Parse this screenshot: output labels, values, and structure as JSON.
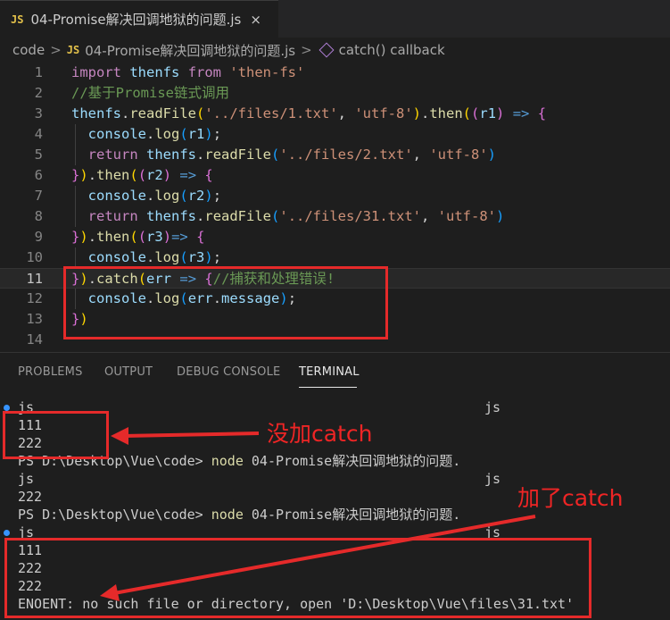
{
  "tab": {
    "badge": "JS",
    "title": "04-Promise解决回调地狱的问题.js",
    "close": "×"
  },
  "breadcrumb": {
    "root": "code",
    "sep": ">",
    "badge": "JS",
    "file": "04-Promise解决回调地狱的问题.js",
    "symbol": "catch() callback"
  },
  "editor": {
    "line_numbers": [
      "1",
      "2",
      "3",
      "4",
      "5",
      "6",
      "7",
      "8",
      "9",
      "10",
      "11",
      "12",
      "13",
      "14"
    ],
    "current_line": "11",
    "lines": [
      [
        {
          "c": "kw",
          "t": "import"
        },
        {
          "c": "op",
          "t": " "
        },
        {
          "c": "id",
          "t": "thenfs"
        },
        {
          "c": "op",
          "t": " "
        },
        {
          "c": "kw",
          "t": "from"
        },
        {
          "c": "op",
          "t": " "
        },
        {
          "c": "str",
          "t": "'then-fs'"
        }
      ],
      [
        {
          "c": "cm",
          "t": "//基于Promise链式调用"
        }
      ],
      [
        {
          "c": "id",
          "t": "thenfs"
        },
        {
          "c": "op",
          "t": "."
        },
        {
          "c": "fn",
          "t": "readFile"
        },
        {
          "c": "b1",
          "t": "("
        },
        {
          "c": "str",
          "t": "'../files/1.txt'"
        },
        {
          "c": "op",
          "t": ", "
        },
        {
          "c": "str",
          "t": "'utf-8'"
        },
        {
          "c": "b1",
          "t": ")"
        },
        {
          "c": "op",
          "t": "."
        },
        {
          "c": "fn",
          "t": "then"
        },
        {
          "c": "b1",
          "t": "("
        },
        {
          "c": "b2",
          "t": "("
        },
        {
          "c": "id",
          "t": "r1"
        },
        {
          "c": "b2",
          "t": ")"
        },
        {
          "c": "op",
          "t": " "
        },
        {
          "c": "kw2",
          "t": "=>"
        },
        {
          "c": "op",
          "t": " "
        },
        {
          "c": "b2",
          "t": "{"
        }
      ],
      [
        {
          "c": "op",
          "t": "  "
        },
        {
          "c": "id",
          "t": "console"
        },
        {
          "c": "op",
          "t": "."
        },
        {
          "c": "fn",
          "t": "log"
        },
        {
          "c": "b3",
          "t": "("
        },
        {
          "c": "id",
          "t": "r1"
        },
        {
          "c": "b3",
          "t": ")"
        },
        {
          "c": "op",
          "t": ";"
        }
      ],
      [
        {
          "c": "op",
          "t": "  "
        },
        {
          "c": "kw",
          "t": "return"
        },
        {
          "c": "op",
          "t": " "
        },
        {
          "c": "id",
          "t": "thenfs"
        },
        {
          "c": "op",
          "t": "."
        },
        {
          "c": "fn",
          "t": "readFile"
        },
        {
          "c": "b3",
          "t": "("
        },
        {
          "c": "str",
          "t": "'../files/2.txt'"
        },
        {
          "c": "op",
          "t": ", "
        },
        {
          "c": "str",
          "t": "'utf-8'"
        },
        {
          "c": "b3",
          "t": ")"
        }
      ],
      [
        {
          "c": "b2",
          "t": "}"
        },
        {
          "c": "b1",
          "t": ")"
        },
        {
          "c": "op",
          "t": "."
        },
        {
          "c": "fn",
          "t": "then"
        },
        {
          "c": "b1",
          "t": "("
        },
        {
          "c": "b2",
          "t": "("
        },
        {
          "c": "id",
          "t": "r2"
        },
        {
          "c": "b2",
          "t": ")"
        },
        {
          "c": "op",
          "t": " "
        },
        {
          "c": "kw2",
          "t": "=>"
        },
        {
          "c": "op",
          "t": " "
        },
        {
          "c": "b2",
          "t": "{"
        }
      ],
      [
        {
          "c": "op",
          "t": "  "
        },
        {
          "c": "id",
          "t": "console"
        },
        {
          "c": "op",
          "t": "."
        },
        {
          "c": "fn",
          "t": "log"
        },
        {
          "c": "b3",
          "t": "("
        },
        {
          "c": "id",
          "t": "r2"
        },
        {
          "c": "b3",
          "t": ")"
        },
        {
          "c": "op",
          "t": ";"
        }
      ],
      [
        {
          "c": "op",
          "t": "  "
        },
        {
          "c": "kw",
          "t": "return"
        },
        {
          "c": "op",
          "t": " "
        },
        {
          "c": "id",
          "t": "thenfs"
        },
        {
          "c": "op",
          "t": "."
        },
        {
          "c": "fn",
          "t": "readFile"
        },
        {
          "c": "b3",
          "t": "("
        },
        {
          "c": "str",
          "t": "'../files/31.txt'"
        },
        {
          "c": "op",
          "t": ", "
        },
        {
          "c": "str",
          "t": "'utf-8'"
        },
        {
          "c": "b3",
          "t": ")"
        }
      ],
      [
        {
          "c": "b2",
          "t": "}"
        },
        {
          "c": "b1",
          "t": ")"
        },
        {
          "c": "op",
          "t": "."
        },
        {
          "c": "fn",
          "t": "then"
        },
        {
          "c": "b1",
          "t": "("
        },
        {
          "c": "b2",
          "t": "("
        },
        {
          "c": "id",
          "t": "r3"
        },
        {
          "c": "b2",
          "t": ")"
        },
        {
          "c": "kw2",
          "t": "=>"
        },
        {
          "c": "op",
          "t": " "
        },
        {
          "c": "b2",
          "t": "{"
        }
      ],
      [
        {
          "c": "op",
          "t": "  "
        },
        {
          "c": "id",
          "t": "console"
        },
        {
          "c": "op",
          "t": "."
        },
        {
          "c": "fn",
          "t": "log"
        },
        {
          "c": "b3",
          "t": "("
        },
        {
          "c": "id",
          "t": "r3"
        },
        {
          "c": "b3",
          "t": ")"
        },
        {
          "c": "op",
          "t": ";"
        }
      ],
      [
        {
          "c": "b2",
          "t": "}"
        },
        {
          "c": "b1",
          "t": ")"
        },
        {
          "c": "op",
          "t": "."
        },
        {
          "c": "fn",
          "t": "catch"
        },
        {
          "c": "b1",
          "t": "("
        },
        {
          "c": "id",
          "t": "err"
        },
        {
          "c": "op",
          "t": " "
        },
        {
          "c": "kw2",
          "t": "=>"
        },
        {
          "c": "op",
          "t": " "
        },
        {
          "c": "b2",
          "t": "{"
        },
        {
          "c": "cm",
          "t": "//捕获和处理错误!"
        }
      ],
      [
        {
          "c": "op",
          "t": "  "
        },
        {
          "c": "id",
          "t": "console"
        },
        {
          "c": "op",
          "t": "."
        },
        {
          "c": "fn",
          "t": "log"
        },
        {
          "c": "b3",
          "t": "("
        },
        {
          "c": "id",
          "t": "err"
        },
        {
          "c": "op",
          "t": "."
        },
        {
          "c": "id",
          "t": "message"
        },
        {
          "c": "b3",
          "t": ")"
        },
        {
          "c": "op",
          "t": ";"
        }
      ],
      [
        {
          "c": "b2",
          "t": "}"
        },
        {
          "c": "b1",
          "t": ")"
        }
      ],
      []
    ]
  },
  "panel": {
    "tabs": [
      "PROBLEMS",
      "OUTPUT",
      "DEBUG CONSOLE",
      "TERMINAL"
    ],
    "active_tab": "TERMINAL",
    "terminal_lines": [
      {
        "left": "js",
        "right": "js",
        "dot": true
      },
      {
        "left": "111"
      },
      {
        "left": "222"
      },
      {
        "prompt": "PS D:\\Desktop\\Vue\\code> ",
        "cmd": "node",
        "args": " 04-Promise解决回调地狱的问题."
      },
      {
        "left": "js",
        "right": "js"
      },
      {
        "left": "222"
      },
      {
        "prompt": "PS D:\\Desktop\\Vue\\code> ",
        "cmd": "node",
        "args": " 04-Promise解决回调地狱的问题."
      },
      {
        "left": "js",
        "right": "js",
        "dot": true
      },
      {
        "left": "111"
      },
      {
        "left": "222"
      },
      {
        "left": "222"
      },
      {
        "left": "ENOENT: no such file or directory, open 'D:\\Desktop\\Vue\\files\\31.txt'"
      }
    ]
  },
  "annotations": {
    "without_catch": "没加catch",
    "with_catch": "加了catch"
  },
  "colors": {
    "annotation": "#e52a2a",
    "background": "#1e1e1e"
  }
}
